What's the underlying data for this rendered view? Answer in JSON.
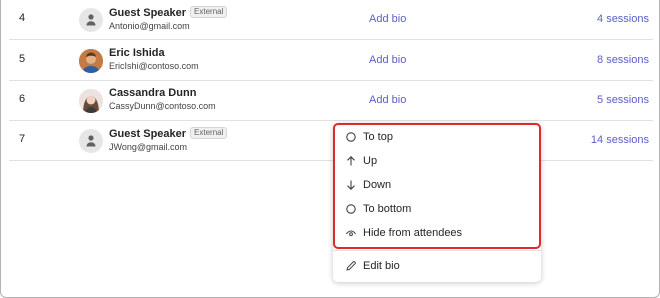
{
  "rows": [
    {
      "num": "4",
      "name": "Guest Speaker",
      "badge": "External",
      "email": "Antonio@gmail.com",
      "avatar": "generic-person-icon",
      "bio": "Add bio",
      "sessions": "4 sessions"
    },
    {
      "num": "5",
      "name": "Eric Ishida",
      "badge": "",
      "email": "EricIshi@contoso.com",
      "avatar": "photo",
      "bio": "Add bio",
      "sessions": "8 sessions"
    },
    {
      "num": "6",
      "name": "Cassandra Dunn",
      "badge": "",
      "email": "CassyDunn@contoso.com",
      "avatar": "photo",
      "bio": "Add bio",
      "sessions": "5 sessions"
    },
    {
      "num": "7",
      "name": "Guest Speaker",
      "badge": "External",
      "email": "JWong@gmail.com",
      "avatar": "generic-person-icon",
      "bio": "",
      "sessions": "14 sessions"
    }
  ],
  "menu": {
    "items": [
      {
        "label": "To top",
        "icon": "circle-icon"
      },
      {
        "label": "Up",
        "icon": "arrow-up-icon"
      },
      {
        "label": "Down",
        "icon": "arrow-down-icon"
      },
      {
        "label": "To bottom",
        "icon": "circle-icon"
      },
      {
        "label": "Hide from attendees",
        "icon": "eye-off-icon"
      }
    ],
    "edit": {
      "label": "Edit bio",
      "icon": "pencil-icon"
    }
  },
  "colors": {
    "link": "#5b5fc7",
    "highlight": "#dc2b2b"
  }
}
